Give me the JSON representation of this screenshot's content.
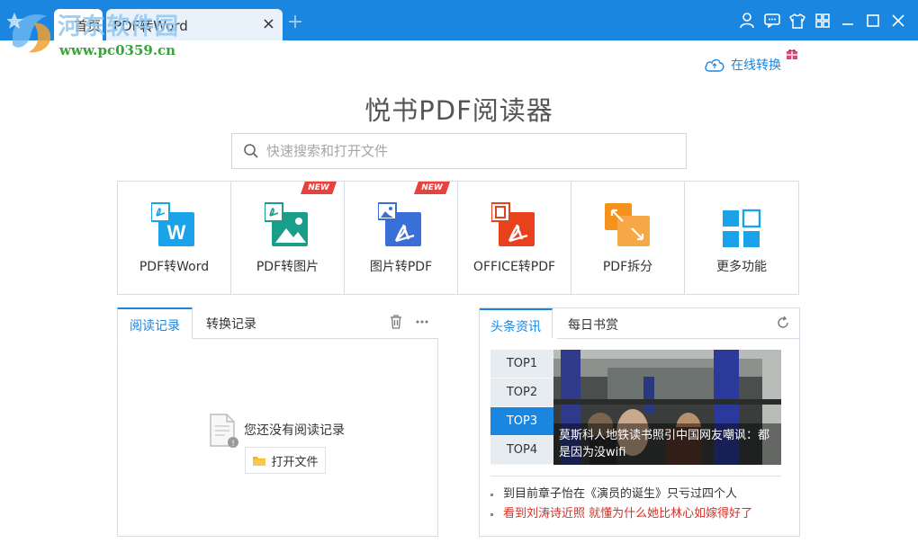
{
  "watermark": {
    "brand": "河东软件园",
    "url": "www.pc0359.cn"
  },
  "tabs": [
    {
      "label": "首页"
    },
    {
      "label": "PDF转Word",
      "close": "×"
    }
  ],
  "tab_add": "+",
  "toolbar_icons": [
    "user-icon",
    "message-icon",
    "skin-icon",
    "apps-icon",
    "minimize-icon",
    "maximize-icon",
    "close-icon"
  ],
  "online_convert": "在线转换",
  "app_title": "悦书PDF阅读器",
  "search": {
    "placeholder": "快速搜索和打开文件"
  },
  "features": [
    {
      "label": "PDF转Word",
      "badge": "",
      "icon": "pdf-to-word-icon",
      "color": "#1aa3e8"
    },
    {
      "label": "PDF转图片",
      "badge": "NEW",
      "icon": "pdf-to-image-icon",
      "color": "#1a9e8a"
    },
    {
      "label": "图片转PDF",
      "badge": "NEW",
      "icon": "image-to-pdf-icon",
      "color": "#3a6fd8"
    },
    {
      "label": "OFFICE转PDF",
      "badge": "",
      "icon": "office-to-pdf-icon",
      "color": "#e8421d"
    },
    {
      "label": "PDF拆分",
      "badge": "",
      "icon": "pdf-split-icon",
      "color": "#f5921e"
    },
    {
      "label": "更多功能",
      "badge": "",
      "icon": "more-features-icon",
      "color": "#1aa3e8"
    }
  ],
  "records": {
    "tabs": [
      "阅读记录",
      "转换记录"
    ],
    "empty_text": "您还没有阅读记录",
    "open_button": "打开文件"
  },
  "news": {
    "tabs": [
      "头条资讯",
      "每日书赏"
    ],
    "tops": [
      "TOP1",
      "TOP2",
      "TOP3",
      "TOP4"
    ],
    "active_top": "TOP3",
    "caption": "莫斯科人地铁读书照引中国网友嘲讽：都是因为没wifi",
    "items": [
      {
        "text": "到目前章子怡在《演员的诞生》只亏过四个人",
        "hot": false
      },
      {
        "text": "看到刘涛诗近照 就懂为什么她比林心如嫁得好了",
        "hot": true
      }
    ]
  }
}
